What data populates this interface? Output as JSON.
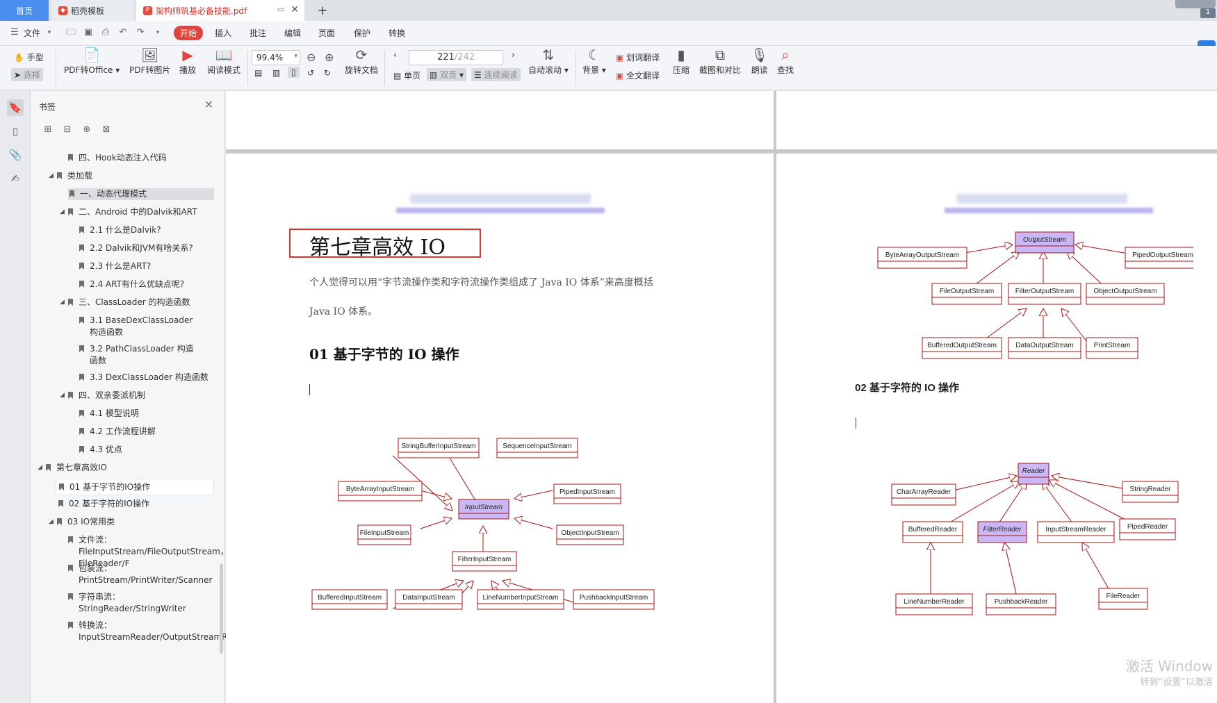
{
  "tabs": {
    "home": "首页",
    "template": "稻壳模板",
    "pdf": "架构师筑基必备技能.pdf",
    "add": "+"
  },
  "menu": {
    "file": "文件",
    "start": "开始",
    "insert": "插入",
    "comment": "批注",
    "edit": "编辑",
    "page": "页面",
    "protect": "保护",
    "convert": "转换"
  },
  "toolbar": {
    "hand": "手型",
    "select": "选择",
    "pdf_to_office": "PDF转Office",
    "pdf_to_image": "PDF转图片",
    "play": "播放",
    "read_mode": "阅读模式",
    "zoom": "99.4%",
    "rotate": "旋转文档",
    "page_current": "221",
    "page_total": "/242",
    "single": "单页",
    "double": "双页",
    "continuous": "连续阅读",
    "auto_scroll": "自动滚动",
    "background": "背景",
    "word_translate": "划词翻译",
    "full_translate": "全文翻译",
    "compress": "压缩",
    "screenshot_compare": "截图和对比",
    "read_aloud": "朗读",
    "find": "查找"
  },
  "sidebar": {
    "title": "书签",
    "items": [
      {
        "label": "四、Hook动态注入代码"
      },
      {
        "label": "类加载"
      },
      {
        "label": "一、动态代理模式"
      },
      {
        "label": "二、Android 中的Dalvik和ART"
      },
      {
        "label": "2.1 什么是Dalvik?"
      },
      {
        "label": "2.2 Dalvik和JVM有啥关系?"
      },
      {
        "label": "2.3 什么是ART?"
      },
      {
        "label": "2.4 ART有什么优缺点呢?"
      },
      {
        "label": "三、ClassLoader 的构造函数"
      },
      {
        "label": "3.1 BaseDexClassLoader 构造函数"
      },
      {
        "label": "3.2 PathClassLoader 构造函数"
      },
      {
        "label": "3.3 DexClassLoader 构造函数"
      },
      {
        "label": "四、双亲委派机制"
      },
      {
        "label": "4.1 模型说明"
      },
      {
        "label": "4.2 工作流程讲解"
      },
      {
        "label": "4.3 优点"
      },
      {
        "label": "第七章高效IO"
      },
      {
        "label": "01 基于字节的IO操作"
      },
      {
        "label": "02 基于字符的IO操作"
      },
      {
        "label": "03 IO常用类"
      },
      {
        "label": "文件流：FileInputStream/FileOutputStream， FileReader/F"
      },
      {
        "label": "包装流：PrintStream/PrintWriter/Scanner"
      },
      {
        "label": "字符串流：StringReader/StringWriter"
      },
      {
        "label": "转换流：InputStreamReader/OutputStreamReader"
      }
    ]
  },
  "doc": {
    "chapter_title": "第七章高效 IO",
    "para1": "个人觉得可以用“字节流操作类和字符流操作类组成了 Java IO 体系”来高度概括",
    "para2": "Java IO 体系。",
    "sec1": "01  基于字节的 IO 操作",
    "sec2": "02  基于字符的 IO 操作",
    "input_diagram": {
      "center": "InputStream",
      "nodes": [
        "StringBufferInputStream",
        "SequenceInputStream",
        "ByteArrayInputStream",
        "PipedInputStream",
        "FileInputStream",
        "ObjectInputStream",
        "FilterInputStream",
        "BufferedInputStream",
        "DataInputStream",
        "LineNumberInputStream",
        "PushbackInputStream"
      ]
    },
    "output_diagram": {
      "center": "OutputStream",
      "nodes": [
        "ByteArrayOutputStream",
        "PipedOutputStream",
        "FileOutputStream",
        "FilterOutputStream",
        "ObjectOutputStream",
        "BufferedOutputStream",
        "DataOutputStream",
        "PrintStream"
      ]
    },
    "reader_diagram": {
      "center": "Reader",
      "nodes": [
        "CharArrayReader",
        "StringReader",
        "BufferedReader",
        "FilterReader",
        "InputStreamReader",
        "PipedReader",
        "LineNumberReader",
        "PushbackReader",
        "FileReader"
      ]
    }
  },
  "watermark": {
    "line1": "激活 Window",
    "line2": "转到“设置”以激活"
  },
  "corner_badge": "1"
}
